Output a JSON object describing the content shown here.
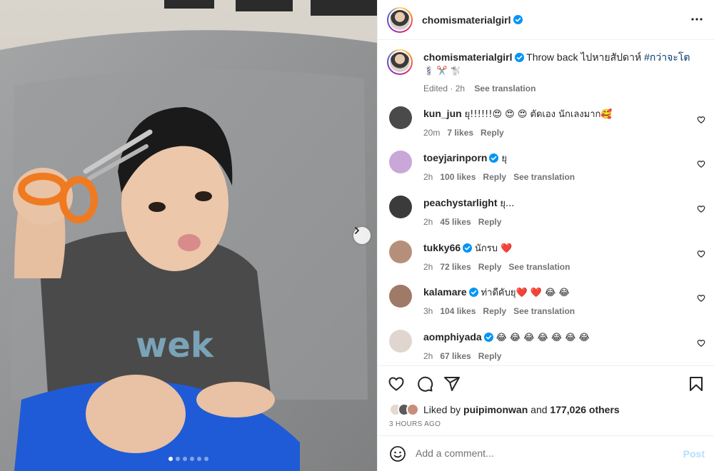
{
  "post": {
    "author": "chomismaterialgirl",
    "caption_text": "Throw back ไปหายสัปดาห์",
    "caption_hashtag": "#กว่าจะโต",
    "caption_emoji": "💈 ✂️ 🐩",
    "caption_edited": "Edited · 2h",
    "see_translation": "See translation"
  },
  "carousel": {
    "slide_count": 6,
    "active_index": 0,
    "next_icon": "chevron-right-icon"
  },
  "comments": [
    {
      "user": "kun_jun",
      "verified": false,
      "text": "ยุ!!!!!!😍 😍 😍 ตัดเอง นักเลงมาก🥰",
      "time": "20m",
      "likes": "7 likes",
      "reply": "Reply",
      "translate": ""
    },
    {
      "user": "toeyjarinporn",
      "verified": true,
      "text": "ยุ",
      "time": "2h",
      "likes": "100 likes",
      "reply": "Reply",
      "translate": "See translation"
    },
    {
      "user": "peachystarlight",
      "verified": false,
      "text": "ยุ...",
      "time": "2h",
      "likes": "45 likes",
      "reply": "Reply",
      "translate": ""
    },
    {
      "user": "tukky66",
      "verified": true,
      "text": "นักรบ ❤️",
      "time": "2h",
      "likes": "72 likes",
      "reply": "Reply",
      "translate": "See translation"
    },
    {
      "user": "kalamare",
      "verified": true,
      "text": "ท่าดีคับยุ❤️ ❤️ 😂 😂",
      "time": "3h",
      "likes": "104 likes",
      "reply": "Reply",
      "translate": "See translation"
    },
    {
      "user": "aomphiyada",
      "verified": true,
      "text": "😂 😂 😂 😂 😂 😂 😂",
      "time": "2h",
      "likes": "67 likes",
      "reply": "Reply",
      "translate": ""
    }
  ],
  "likes": {
    "prefix": "Liked by",
    "user": "puipimonwan",
    "middle": "and",
    "others": "177,026 others"
  },
  "timestamp": "3 HOURS AGO",
  "add_comment": {
    "placeholder": "Add a comment...",
    "post_label": "Post"
  },
  "colors": {
    "verified_blue": "#0095f6",
    "post_disabled": "#b2dffc",
    "hashtag": "#00376b",
    "meta_gray": "#737373"
  }
}
